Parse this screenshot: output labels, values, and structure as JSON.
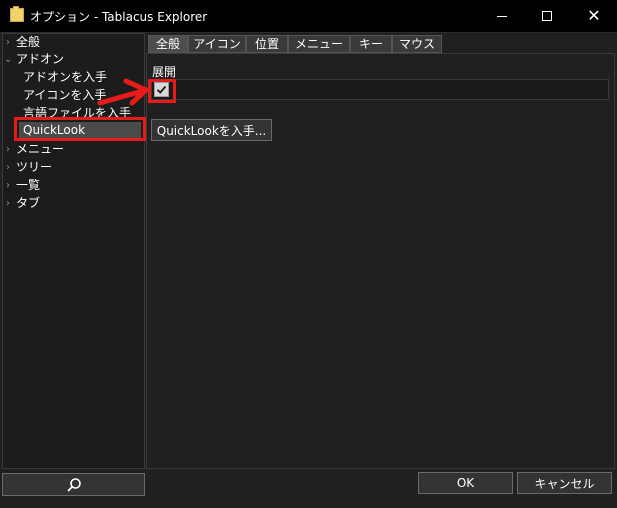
{
  "window": {
    "title": "オプション - Tablacus Explorer",
    "minimize_icon": "minimize-icon",
    "maximize_icon": "maximize-icon",
    "close_icon": "close-icon"
  },
  "sidebar": {
    "items": [
      {
        "label": "全般",
        "expanded": false
      },
      {
        "label": "アドオン",
        "expanded": true
      },
      {
        "label": "アドオンを入手"
      },
      {
        "label": "アイコンを入手"
      },
      {
        "label": "言語ファイルを入手"
      },
      {
        "label": "QuickLook",
        "selected": true
      },
      {
        "label": "メニュー",
        "expanded": false
      },
      {
        "label": "ツリー",
        "expanded": false
      },
      {
        "label": "一覧",
        "expanded": false
      },
      {
        "label": "タブ",
        "expanded": false
      }
    ],
    "search_icon": "search-icon"
  },
  "tabs": [
    {
      "label": "全般",
      "active": true
    },
    {
      "label": "アイコン"
    },
    {
      "label": "位置"
    },
    {
      "label": "メニュー"
    },
    {
      "label": "キー"
    },
    {
      "label": "マウス"
    }
  ],
  "content": {
    "section_label": "展開",
    "expand_checked": true,
    "get_button": "QuickLookを入手..."
  },
  "footer": {
    "ok": "OK",
    "cancel": "キャンセル"
  },
  "annotation": {
    "color": "#e81b1b"
  }
}
